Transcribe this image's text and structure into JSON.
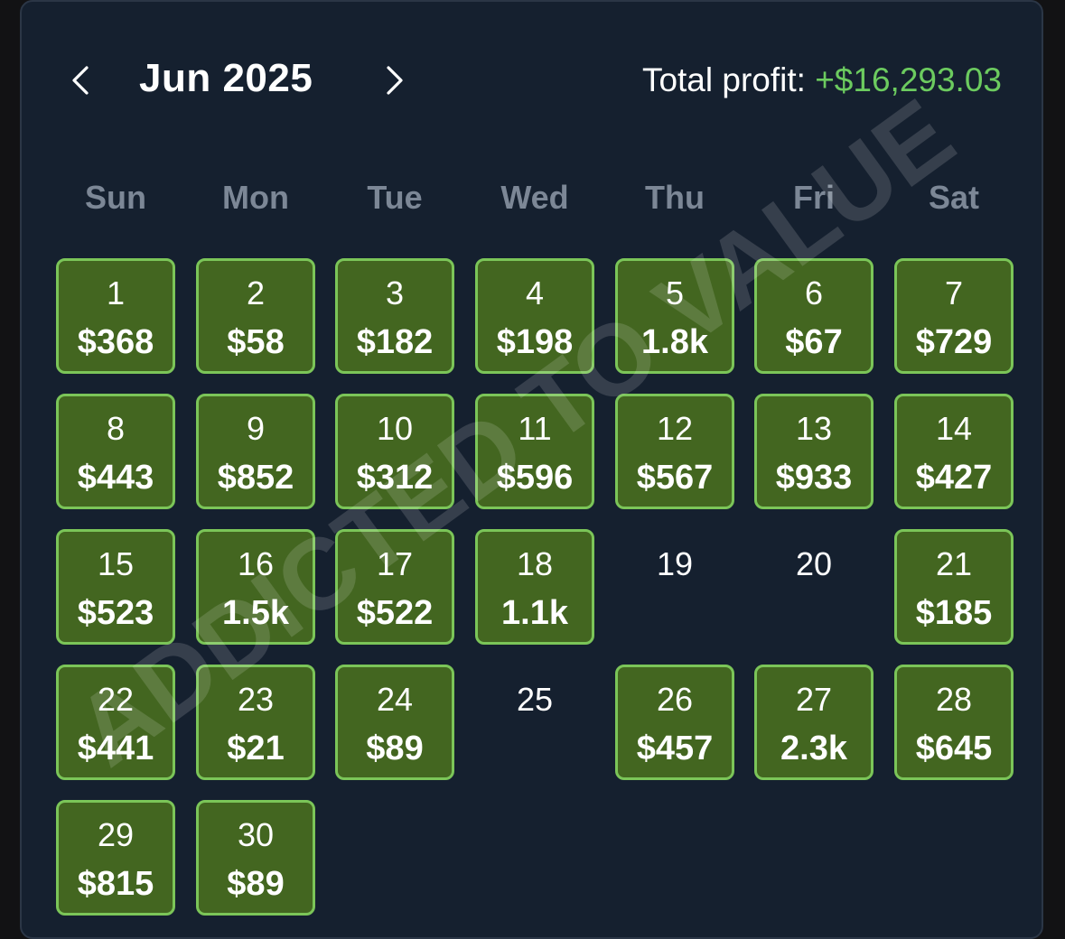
{
  "header": {
    "month": "Jun 2025",
    "total_label": "Total profit:",
    "total_value": "+$16,293.03"
  },
  "weekdays": [
    "Sun",
    "Mon",
    "Tue",
    "Wed",
    "Thu",
    "Fri",
    "Sat"
  ],
  "days": [
    {
      "num": "1",
      "amount": "$368"
    },
    {
      "num": "2",
      "amount": "$58"
    },
    {
      "num": "3",
      "amount": "$182"
    },
    {
      "num": "4",
      "amount": "$198"
    },
    {
      "num": "5",
      "amount": "1.8k"
    },
    {
      "num": "6",
      "amount": "$67"
    },
    {
      "num": "7",
      "amount": "$729"
    },
    {
      "num": "8",
      "amount": "$443"
    },
    {
      "num": "9",
      "amount": "$852"
    },
    {
      "num": "10",
      "amount": "$312"
    },
    {
      "num": "11",
      "amount": "$596"
    },
    {
      "num": "12",
      "amount": "$567"
    },
    {
      "num": "13",
      "amount": "$933"
    },
    {
      "num": "14",
      "amount": "$427"
    },
    {
      "num": "15",
      "amount": "$523"
    },
    {
      "num": "16",
      "amount": "1.5k"
    },
    {
      "num": "17",
      "amount": "$522"
    },
    {
      "num": "18",
      "amount": "1.1k"
    },
    {
      "num": "19",
      "amount": ""
    },
    {
      "num": "20",
      "amount": ""
    },
    {
      "num": "21",
      "amount": "$185"
    },
    {
      "num": "22",
      "amount": "$441"
    },
    {
      "num": "23",
      "amount": "$21"
    },
    {
      "num": "24",
      "amount": "$89"
    },
    {
      "num": "25",
      "amount": ""
    },
    {
      "num": "26",
      "amount": "$457"
    },
    {
      "num": "27",
      "amount": "2.3k"
    },
    {
      "num": "28",
      "amount": "$645"
    },
    {
      "num": "29",
      "amount": "$815"
    },
    {
      "num": "30",
      "amount": "$89"
    }
  ],
  "watermark": "ADDICTED TO VALUE",
  "colors": {
    "panel_bg": "#15202f",
    "profit_tile_bg": "#436620",
    "profit_tile_border": "#7bc558",
    "total_value": "#6ccb5f",
    "weekday_text": "#7c8796"
  },
  "icons": {
    "prev": "chevron-left-icon",
    "next": "chevron-right-icon"
  }
}
